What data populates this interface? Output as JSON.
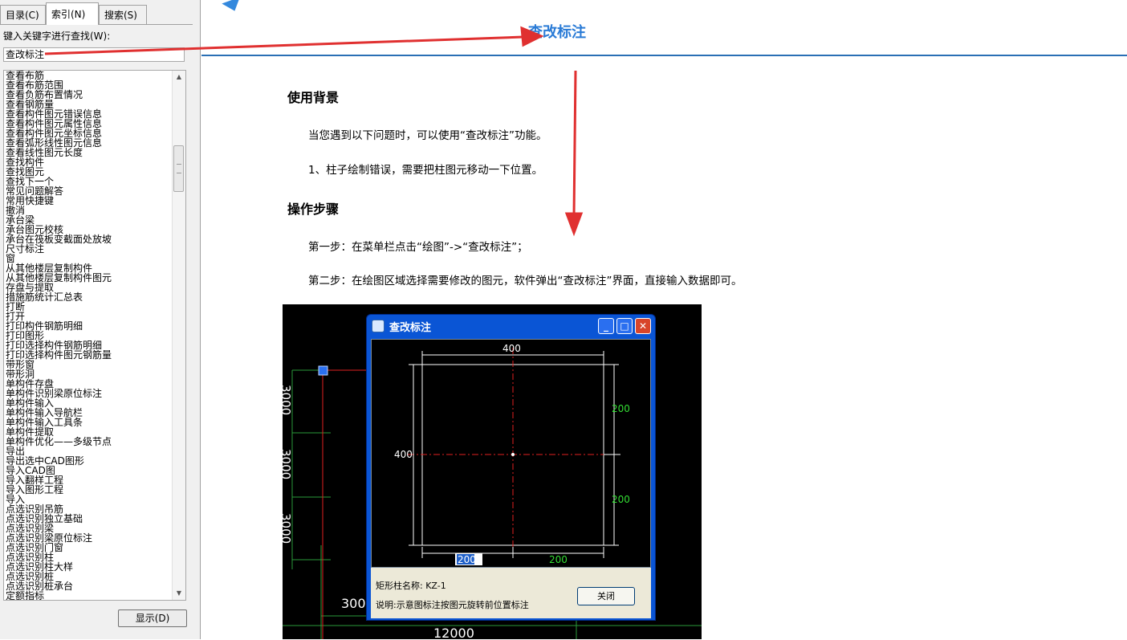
{
  "left_pane": {
    "tabs": [
      {
        "label": "目录(C)"
      },
      {
        "label": "索引(N)"
      },
      {
        "label": "搜索(S)"
      }
    ],
    "keyword_label": "键入关键字进行查找(W):",
    "keyword_value": "查改标注",
    "index_items": [
      "查看布筋",
      "查看布筋范围",
      "查看负筋布置情况",
      "查看钢筋量",
      "查看构件图元错误信息",
      "查看构件图元属性信息",
      "查看构件图元坐标信息",
      "查看弧形线性图元信息",
      "查看线性图元长度",
      "查找构件",
      "查找图元",
      "查找下一个",
      "常见问题解答",
      "常用快捷键",
      "撤消",
      "承台梁",
      "承台图元校核",
      "承台在筏板变截面处放坡",
      "尺寸标注",
      "窗",
      "从其他楼层复制构件",
      "从其他楼层复制构件图元",
      "存盘与提取",
      "措施筋统计汇总表",
      "打断",
      "打开",
      "打印构件钢筋明细",
      "打印图形",
      "打印选择构件钢筋明细",
      "打印选择构件图元钢筋量",
      "带形窗",
      "带形洞",
      "单构件存盘",
      "单构件识别梁原位标注",
      "单构件输入",
      "单构件输入导航栏",
      "单构件输入工具条",
      "单构件提取",
      "单构件优化——多级节点",
      "导出",
      "导出选中CAD图形",
      "导入CAD图",
      "导入翻样工程",
      "导入图形工程",
      "导入",
      "点选识别吊筋",
      "点选识别独立基础",
      "点选识别梁",
      "点选识别梁原位标注",
      "点选识别门窗",
      "点选识别柱",
      "点选识别柱大样",
      "点选识别桩",
      "点选识别桩承台",
      "定额指标"
    ],
    "display_button": "显示(D)"
  },
  "content": {
    "title": "查改标注",
    "section1_heading": "使用背景",
    "section1_p1": "当您遇到以下问题时，可以使用“查改标注”功能。",
    "section1_p2": "1、柱子绘制错误，需要把柱图元移动一下位置。",
    "section2_heading": "操作步骤",
    "section2_p1": "第一步：在菜单栏点击“绘图”->“查改标注”；",
    "section2_p2": "第二步：在绘图区域选择需要修改的图元，软件弹出“查改标注”界面，直接输入数据即可。"
  },
  "screenshot": {
    "axis_dims": [
      "3000",
      "3000",
      "3000"
    ],
    "bottom_dim_1": "300",
    "bottom_dim_2": "12000",
    "dialog": {
      "title": "查改标注",
      "dim_top": "400",
      "dim_left": "400",
      "dim_right_top": "200",
      "dim_right_bottom": "200",
      "dim_bottom_left": "200",
      "dim_bottom_right": "200",
      "column_name": "矩形柱名称: KZ-1",
      "note": "说明:示意图标注按图元旋转前位置标注",
      "close_button": "关闭"
    }
  },
  "colors": {
    "title_blue": "#2a7bd6",
    "arrow_red": "#e03030",
    "dim_green": "#33dd33",
    "dialog_blue": "#0a55d5"
  }
}
